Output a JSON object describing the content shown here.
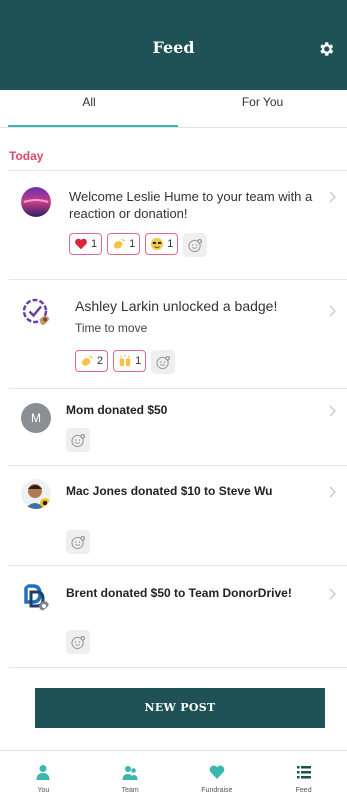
{
  "header": {
    "title": "Feed",
    "settings_icon": "gear-icon"
  },
  "tabs": [
    {
      "label": "All",
      "active": true
    },
    {
      "label": "For You",
      "active": false
    }
  ],
  "section": {
    "today": "Today"
  },
  "feed": [
    {
      "text": "Welcome Leslie Hume to your team with a reaction or donation!",
      "reactions": [
        {
          "emoji": "heart",
          "count": "1"
        },
        {
          "emoji": "clapping-hands",
          "count": "1"
        },
        {
          "emoji": "sunglasses-face",
          "count": "1"
        }
      ]
    },
    {
      "text": "Ashley Larkin unlocked a badge!",
      "subtext": "Time to move",
      "reactions": [
        {
          "emoji": "clapping-hands",
          "count": "2"
        },
        {
          "emoji": "raised-hands",
          "count": "1"
        }
      ]
    },
    {
      "avatar_initial": "M",
      "text": "Mom donated $50"
    },
    {
      "text": "Mac Jones donated $10 to Steve Wu"
    },
    {
      "text": "Brent donated $50 to Team DonorDrive!"
    }
  ],
  "new_post": {
    "label": "NEW POST"
  },
  "nav": [
    {
      "label": "You",
      "icon": "person-icon"
    },
    {
      "label": "Team",
      "icon": "team-icon"
    },
    {
      "label": "Fundraise",
      "icon": "heart-icon"
    },
    {
      "label": "Feed",
      "icon": "list-icon"
    }
  ],
  "colors": {
    "header": "#1f5257",
    "accent": "#3ab8b0",
    "today": "#e0466b",
    "reaction_border": "#e36a86"
  }
}
